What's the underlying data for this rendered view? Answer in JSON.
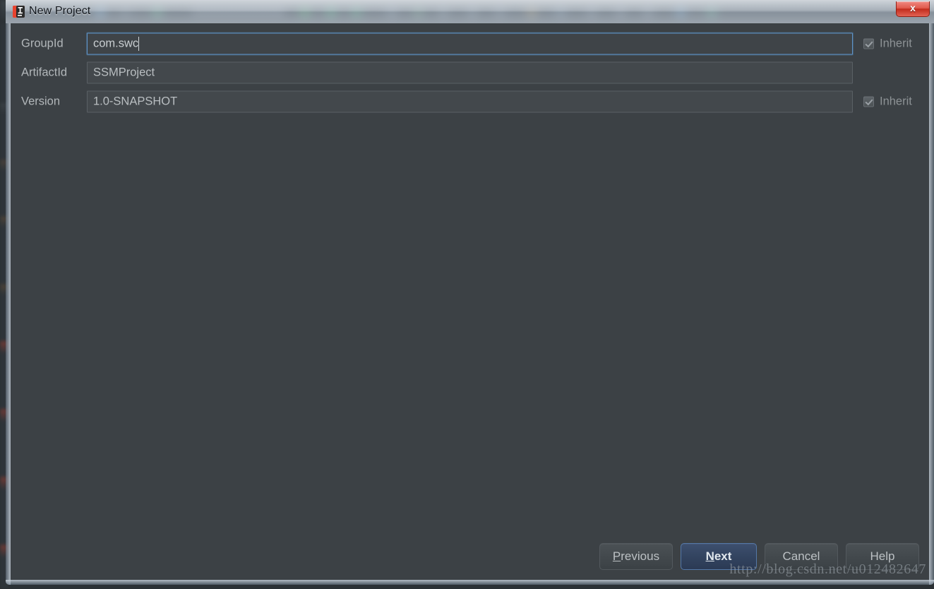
{
  "window": {
    "title": "New Project",
    "app_icon": "intellij-idea-icon",
    "close_label": "x"
  },
  "form": {
    "rows": [
      {
        "label": "GroupId",
        "value": "com.swc",
        "placeholder": "",
        "focused": true,
        "inherit": {
          "label": "Inherit",
          "checked": true,
          "enabled": false,
          "visible": true
        }
      },
      {
        "label": "ArtifactId",
        "value": "SSMProject",
        "placeholder": "",
        "focused": false,
        "inherit": {
          "label": "",
          "checked": false,
          "enabled": false,
          "visible": false
        }
      },
      {
        "label": "Version",
        "value": "1.0-SNAPSHOT",
        "placeholder": "",
        "focused": false,
        "inherit": {
          "label": "Inherit",
          "checked": true,
          "enabled": false,
          "visible": true
        }
      }
    ]
  },
  "buttons": {
    "previous": {
      "label": "Previous",
      "mnemonic": "P",
      "default": false
    },
    "next": {
      "label": "Next",
      "mnemonic": "N",
      "default": true
    },
    "cancel": {
      "label": "Cancel",
      "mnemonic": "",
      "default": false
    },
    "help": {
      "label": "Help",
      "mnemonic": "",
      "default": false
    }
  },
  "watermark": {
    "text": "http://blog.csdn.net/u012482647"
  },
  "colors": {
    "dialog_background": "#3c4145",
    "field_background": "#43484c",
    "field_border": "#5a6065",
    "focus_border": "#5e94c9",
    "label_text": "#b2b7ba",
    "default_button": "#334460",
    "close_button": "#c22c1d"
  }
}
